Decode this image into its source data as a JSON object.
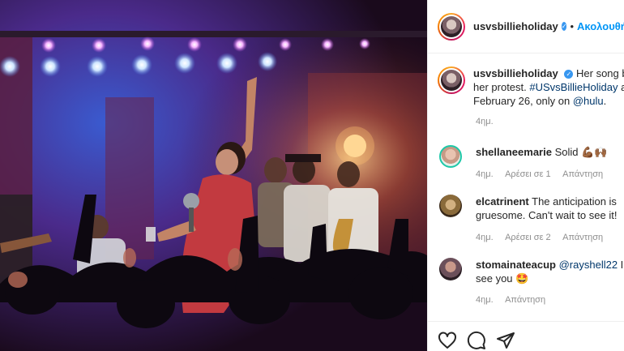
{
  "post": {
    "author": "usvsbillieholiday",
    "follow_label": "Ακολουθήστε",
    "separator": "•",
    "caption": {
      "username": "usvsbillieholiday",
      "line1": "Her song became",
      "line2_hashtag": "her protest. #USvsBillieHoliday",
      "line2_rest": " arrives",
      "line3": "February 26, only on",
      "mention": "@hulu",
      "line3_end": "."
    },
    "time": "4ημ."
  },
  "comments": [
    {
      "username": "shellaneemarie",
      "text": "Solid 💪🏾🙌🏾",
      "time": "4ημ.",
      "likes": "Αρέσει σε 1",
      "reply": "Απάντηση",
      "avatar_color": "#c79a86"
    },
    {
      "username": "elcatrinent",
      "text": "The anticipation is",
      "text2": "gruesome. Can't wait to see it!",
      "time": "4ημ.",
      "likes": "Αρέσει σε 2",
      "reply": "Απάντηση",
      "avatar_color": "#b08a5a"
    },
    {
      "username": "stomainateacup",
      "mention": "@rayshell22",
      "text": " I",
      "text2": "see you 🤩",
      "time": "4ημ.",
      "reply": "Απάντηση",
      "avatar_color": "#6b4f5a"
    }
  ],
  "actions": {
    "icons": [
      "heart-icon",
      "comment-icon",
      "share-icon"
    ]
  },
  "colors": {
    "link": "#0095f6",
    "hashtag": "#00376b",
    "muted": "#8e8e8e"
  }
}
